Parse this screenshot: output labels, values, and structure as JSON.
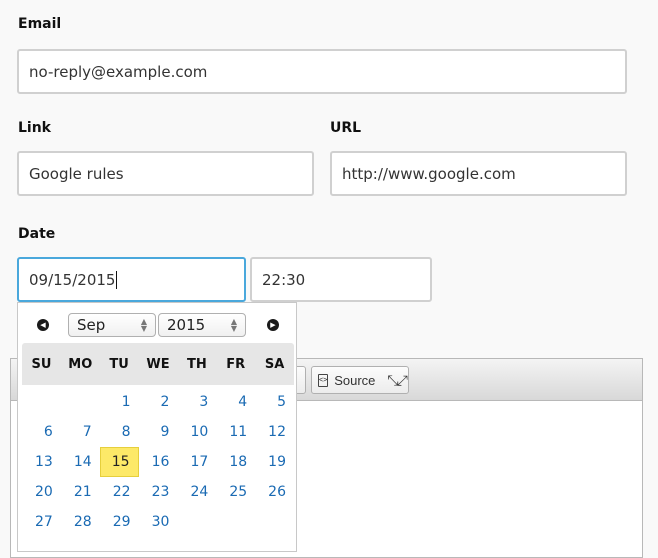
{
  "email": {
    "label": "Email",
    "value": "no-reply@example.com"
  },
  "link": {
    "label": "Link",
    "value": "Google rules"
  },
  "url": {
    "label": "URL",
    "value": "http://www.google.com"
  },
  "date": {
    "label": "Date",
    "value": "09/15/2015",
    "time_value": "22:30"
  },
  "editor": {
    "source_label": "Source",
    "icons": [
      "source-icon",
      "maximize-icon"
    ]
  },
  "datepicker": {
    "prev_icon": "chevron-left-icon",
    "next_icon": "chevron-right-icon",
    "month": "Sep",
    "year": "2015",
    "weekdays": [
      "SU",
      "MO",
      "TU",
      "WE",
      "TH",
      "FR",
      "SA"
    ],
    "leading_blanks": 2,
    "days": [
      "1",
      "2",
      "3",
      "4",
      "5",
      "6",
      "7",
      "8",
      "9",
      "10",
      "11",
      "12",
      "13",
      "14",
      "15",
      "16",
      "17",
      "18",
      "19",
      "20",
      "21",
      "22",
      "23",
      "24",
      "25",
      "26",
      "27",
      "28",
      "29",
      "30"
    ],
    "selected_day": "15",
    "colors": {
      "day_link": "#1a6ab3",
      "selected_bg": "#fde968",
      "focus_border": "#4aa8dc"
    }
  }
}
